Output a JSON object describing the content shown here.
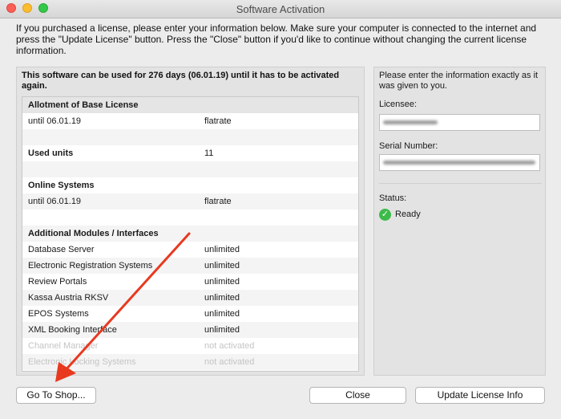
{
  "window": {
    "title": "Software Activation"
  },
  "intro_text": "If you purchased a license, please enter your information below. Make sure your computer is connected to the internet and press the \"Update License\" button. Press the \"Close\" button if you'd like to continue without changing the current license information.",
  "validity_text": "This software can be used for 276 days (06.01.19) until it has to be activated again.",
  "license_table": {
    "sections": [
      {
        "title": "Allotment of Base License",
        "rows": [
          {
            "name": "until 06.01.19",
            "value": "flatrate"
          }
        ]
      },
      {
        "title": "Used units",
        "value": "11"
      },
      {
        "title": "Online Systems",
        "rows": [
          {
            "name": "until 06.01.19",
            "value": "flatrate"
          }
        ]
      },
      {
        "title": "Additional Modules / Interfaces",
        "rows": [
          {
            "name": "Database Server",
            "value": "unlimited"
          },
          {
            "name": "Electronic Registration Systems",
            "value": "unlimited"
          },
          {
            "name": "Review Portals",
            "value": "unlimited"
          },
          {
            "name": "Kassa Austria RKSV",
            "value": "unlimited"
          },
          {
            "name": "EPOS Systems",
            "value": "unlimited"
          },
          {
            "name": "XML Booking Interface",
            "value": "unlimited"
          },
          {
            "name": "Channel Manager",
            "value": "not activated"
          },
          {
            "name": "Electronic Locking Systems",
            "value": "not activated"
          }
        ]
      }
    ]
  },
  "right_panel": {
    "hint": "Please enter the information exactly as it was given to you.",
    "licensee_label": "Licensee:",
    "serial_label": "Serial Number:",
    "status_label": "Status:",
    "status_value": "Ready",
    "status_icon": "checkmark-icon",
    "status_color": "#3dbb4a"
  },
  "buttons": {
    "shop": "Go To Shop...",
    "close": "Close",
    "update": "Update License Info"
  },
  "annotation_color": "#e8391f"
}
